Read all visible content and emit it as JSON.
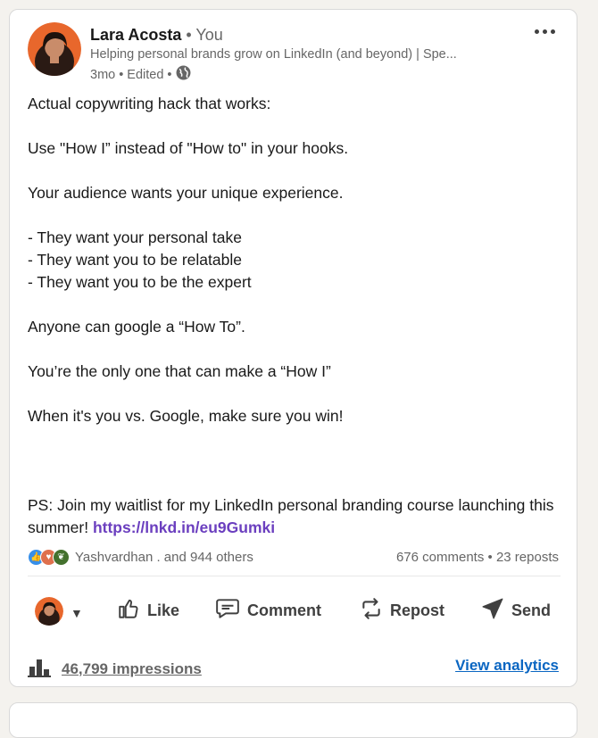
{
  "author": {
    "name": "Lara Acosta",
    "relation": "You",
    "headline": "Helping personal brands grow on LinkedIn (and beyond) | Spe...",
    "time": "3mo",
    "edited": "Edited"
  },
  "post": {
    "lines": [
      "Actual copywriting hack that works:",
      "Use \"How I” instead of \"How to\" in your hooks.",
      "Your audience wants your unique experience.",
      "- They want your personal take\n- They want you to be relatable\n- They want you to be the expert",
      "Anyone can google a “How To”.",
      "You’re the only one that can make a “How I”",
      "When it's you vs. Google, make sure you win!",
      "PS: Join my waitlist for my LinkedIn personal branding course launching this summer! "
    ],
    "link": "https://lnkd.in/eu9Gumki"
  },
  "social": {
    "reactors": "Yashvardhan . and 944 others",
    "comments": "676 comments",
    "separator": "•",
    "reposts": "23 reposts"
  },
  "actions": {
    "like": "Like",
    "comment": "Comment",
    "repost": "Repost",
    "send": "Send"
  },
  "footer": {
    "impressions": "46,799 impressions",
    "analytics": "View analytics"
  },
  "colors": {
    "link": "#6b3fbf",
    "analytics": "#0a66c2",
    "avatar_bg": "#e8672c"
  }
}
